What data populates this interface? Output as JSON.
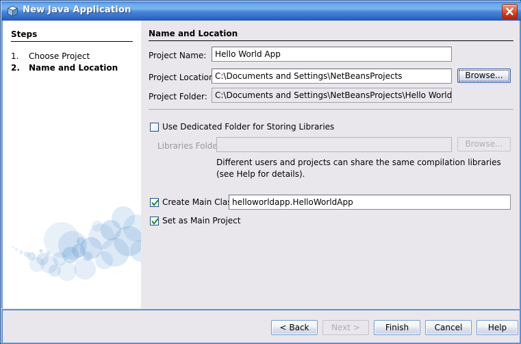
{
  "window": {
    "title": "New Java Application",
    "icon": "java-cube-icon",
    "close_label": "x",
    "accent_color": "#3f7fd4",
    "panel_bg": "#e9e7ec",
    "border_color": "#1c4f9c"
  },
  "steps_panel": {
    "heading": "Steps",
    "items": [
      {
        "number": "1.",
        "label": "Choose Project",
        "current": false
      },
      {
        "number": "2.",
        "label": "Name and Location",
        "current": true
      }
    ]
  },
  "content": {
    "heading": "Name and Location",
    "fields": [
      {
        "label": "Project Name:",
        "value": "Hello World App",
        "placeholder": "",
        "readonly": false
      },
      {
        "label": "Project Location:",
        "value": "C:\\Documents and Settings\\NetBeansProjects",
        "placeholder": "",
        "readonly": false
      },
      {
        "label": "Project Folder:",
        "value": "C:\\Documents and Settings\\NetBeansProjects\\Hello World App",
        "placeholder": "",
        "readonly": true
      }
    ],
    "browse_location_label": "Browse...",
    "dedicated_folder": {
      "label": "Use Dedicated Folder for Storing Libraries",
      "checked": false
    },
    "libraries": {
      "label": "Libraries Folder:",
      "value": "",
      "placeholder": "",
      "browse_label": "Browse...",
      "disabled": true
    },
    "help_lines": [
      "Different users and projects can share the same compilation libraries",
      "(see Help for details)."
    ],
    "main_class": {
      "label": "Create Main Class",
      "checked": true,
      "value": "helloworldapp.HelloWorldApp",
      "placeholder": ""
    },
    "set_main_project": {
      "label": "Set as Main Project",
      "checked": true
    }
  },
  "buttons": [
    {
      "label": "< Back",
      "disabled": false
    },
    {
      "label": "Next >",
      "disabled": true
    },
    {
      "label": "Finish",
      "disabled": false
    },
    {
      "label": "Cancel",
      "disabled": false
    },
    {
      "label": "Help",
      "disabled": false
    }
  ]
}
